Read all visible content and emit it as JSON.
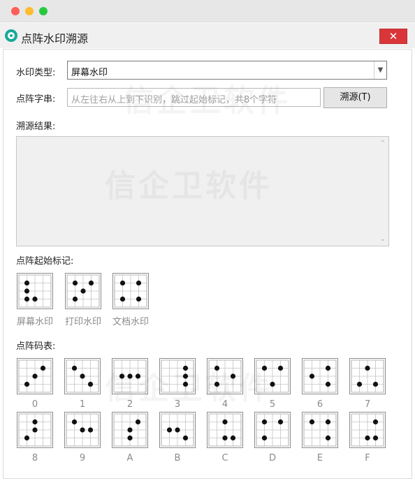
{
  "window": {
    "title": "点阵水印溯源",
    "close": "✕"
  },
  "form": {
    "type_label": "水印类型:",
    "type_value": "屏幕水印",
    "string_label": "点阵字串:",
    "string_placeholder": "从左往右从上到下识别，跳过起始标记，共8个字符",
    "trace_button": "溯源(T)",
    "result_label": "溯源结果:"
  },
  "start_marks": {
    "label": "点阵起始标记:",
    "items": [
      {
        "caption": "屏幕水印",
        "dots": [
          [
            0,
            0
          ],
          [
            1,
            0
          ],
          [
            2,
            0
          ],
          [
            2,
            1
          ]
        ]
      },
      {
        "caption": "打印水印",
        "dots": [
          [
            0,
            0
          ],
          [
            0,
            2
          ],
          [
            1,
            1
          ],
          [
            2,
            0
          ]
        ]
      },
      {
        "caption": "文档水印",
        "dots": [
          [
            0,
            0
          ],
          [
            0,
            2
          ],
          [
            2,
            0
          ],
          [
            2,
            2
          ]
        ]
      }
    ]
  },
  "code_table": {
    "label": "点阵码表:",
    "items": [
      {
        "caption": "0",
        "dots": [
          [
            0,
            2
          ],
          [
            1,
            1
          ],
          [
            2,
            0
          ]
        ]
      },
      {
        "caption": "1",
        "dots": [
          [
            0,
            0
          ],
          [
            1,
            1
          ],
          [
            2,
            2
          ]
        ]
      },
      {
        "caption": "2",
        "dots": [
          [
            1,
            0
          ],
          [
            1,
            1
          ],
          [
            1,
            2
          ]
        ]
      },
      {
        "caption": "3",
        "dots": [
          [
            0,
            2
          ],
          [
            1,
            2
          ],
          [
            2,
            2
          ]
        ]
      },
      {
        "caption": "4",
        "dots": [
          [
            0,
            0
          ],
          [
            1,
            2
          ],
          [
            2,
            0
          ]
        ]
      },
      {
        "caption": "5",
        "dots": [
          [
            0,
            0
          ],
          [
            0,
            2
          ],
          [
            2,
            1
          ]
        ]
      },
      {
        "caption": "6",
        "dots": [
          [
            0,
            2
          ],
          [
            1,
            0
          ],
          [
            2,
            2
          ]
        ]
      },
      {
        "caption": "7",
        "dots": [
          [
            0,
            1
          ],
          [
            2,
            0
          ],
          [
            2,
            2
          ]
        ]
      },
      {
        "caption": "8",
        "dots": [
          [
            0,
            1
          ],
          [
            1,
            1
          ],
          [
            2,
            0
          ]
        ]
      },
      {
        "caption": "9",
        "dots": [
          [
            0,
            0
          ],
          [
            1,
            1
          ],
          [
            1,
            2
          ]
        ]
      },
      {
        "caption": "A",
        "dots": [
          [
            0,
            2
          ],
          [
            1,
            1
          ],
          [
            2,
            1
          ]
        ]
      },
      {
        "caption": "B",
        "dots": [
          [
            1,
            0
          ],
          [
            1,
            1
          ],
          [
            2,
            2
          ]
        ]
      },
      {
        "caption": "C",
        "dots": [
          [
            0,
            1
          ],
          [
            2,
            1
          ],
          [
            2,
            2
          ]
        ]
      },
      {
        "caption": "D",
        "dots": [
          [
            0,
            0
          ],
          [
            0,
            2
          ],
          [
            2,
            0
          ]
        ]
      },
      {
        "caption": "E",
        "dots": [
          [
            0,
            0
          ],
          [
            0,
            2
          ],
          [
            2,
            2
          ]
        ]
      },
      {
        "caption": "F",
        "dots": [
          [
            0,
            2
          ],
          [
            2,
            1
          ],
          [
            2,
            2
          ]
        ]
      }
    ]
  },
  "watermark_text": "信企卫软件"
}
